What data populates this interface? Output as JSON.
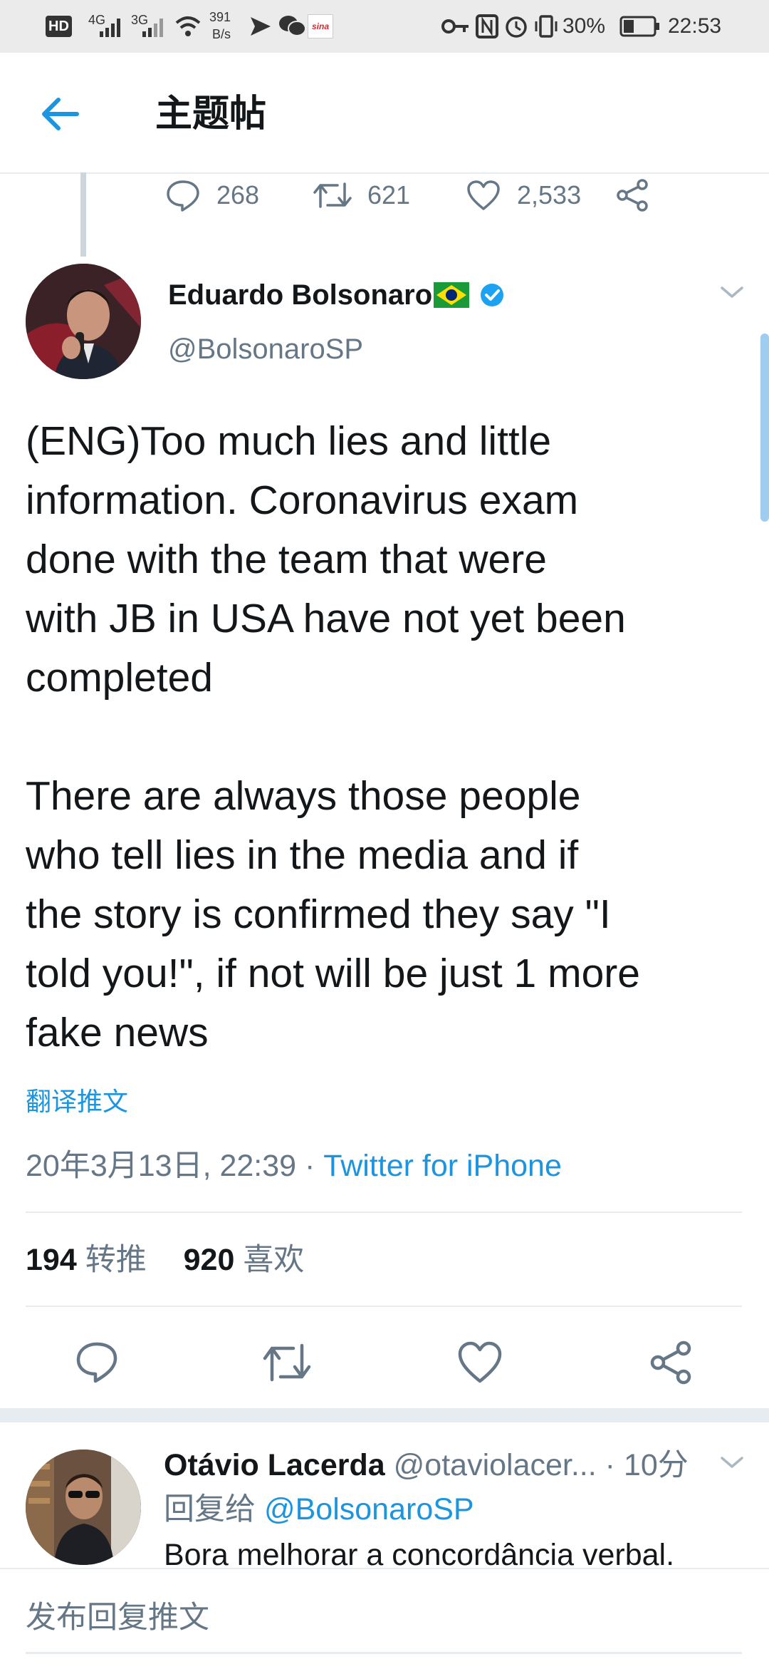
{
  "status_bar": {
    "hd": "HD",
    "net1": "4G",
    "net2": "3G",
    "speed_value": "391",
    "speed_unit": "B/s",
    "app_badge": "sina",
    "battery": "30%",
    "time": "22:53"
  },
  "header": {
    "title": "主题帖"
  },
  "previous_tweet": {
    "replies": "268",
    "retweets": "621",
    "likes": "2,533"
  },
  "tweet": {
    "author_name": "Eduardo Bolsonaro",
    "handle": "@BolsonaroSP",
    "text": "(ENG)Too much lies and little\ninformation. Coronavirus exam\ndone with the team that were\nwith JB in USA have not yet been\ncompleted\n\nThere are always those people\nwho tell lies in the media and if\nthe story is confirmed they say \"I\ntold you!\", if not will be just 1 more\nfake news",
    "translate_label": "翻译推文",
    "timestamp": "20年3月13日, 22:39",
    "separator": " · ",
    "source": "Twitter for iPhone",
    "retweet_count": "194",
    "retweet_label": "转推",
    "like_count": "920",
    "like_label": "喜欢"
  },
  "reply": {
    "author_name": "Otávio Lacerda",
    "handle": "@otaviolacer...",
    "time": "· 10分",
    "replying_prefix": "回复给",
    "replying_to": "@BolsonaroSP",
    "text": "Bora melhorar a concordância verbal."
  },
  "compose": {
    "placeholder": "发布回复推文"
  },
  "colors": {
    "accent": "#1b95e0",
    "secondary_text": "#657786",
    "divider": "#e6ecf0",
    "verified": "#1da1f2"
  },
  "icons": [
    "back-arrow-icon",
    "reply-icon",
    "retweet-icon",
    "like-icon",
    "share-icon",
    "chevron-down-icon",
    "verified-badge-icon",
    "brazil-flag-icon"
  ]
}
